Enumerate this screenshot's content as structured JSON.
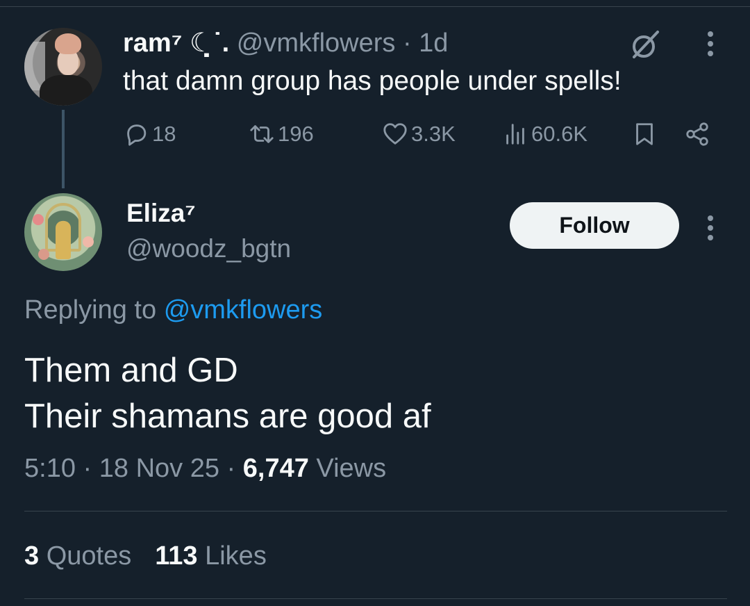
{
  "parent_tweet": {
    "display_name": "ram⁷ ☾̣˙.",
    "handle": "@vmkflowers",
    "separator": "·",
    "time_ago": "1d",
    "text": "that damn group has people under spells!",
    "actions": {
      "replies": "18",
      "retweets": "196",
      "likes": "3.3K",
      "views": "60.6K"
    }
  },
  "main_tweet": {
    "display_name": "Eliza⁷",
    "handle": "@woodz_bgtn",
    "follow_label": "Follow",
    "replying_prefix": "Replying to",
    "replying_to": "@vmkflowers",
    "text_line_1": "Them and GD",
    "text_line_2": "Their shamans are good af",
    "time": "5:10",
    "date": "18 Nov 25",
    "separator": "·",
    "views_count": "6,747",
    "views_label": "Views",
    "quotes_count": "3",
    "quotes_label": "Quotes",
    "likes_count": "113",
    "likes_label": "Likes"
  },
  "icons": {
    "reply": "reply-icon",
    "retweet": "retweet-icon",
    "like": "heart-icon",
    "views": "bar-chart-icon",
    "bookmark": "bookmark-icon",
    "share": "share-icon",
    "grok": "grok-icon",
    "more": "more-vertical-icon"
  },
  "colors": {
    "background": "#15202b",
    "primary_text": "#f7f9f9",
    "secondary_text": "#8b98a5",
    "link": "#1d9bf0",
    "divider": "#38444d",
    "follow_button_bg": "#eff3f4"
  }
}
